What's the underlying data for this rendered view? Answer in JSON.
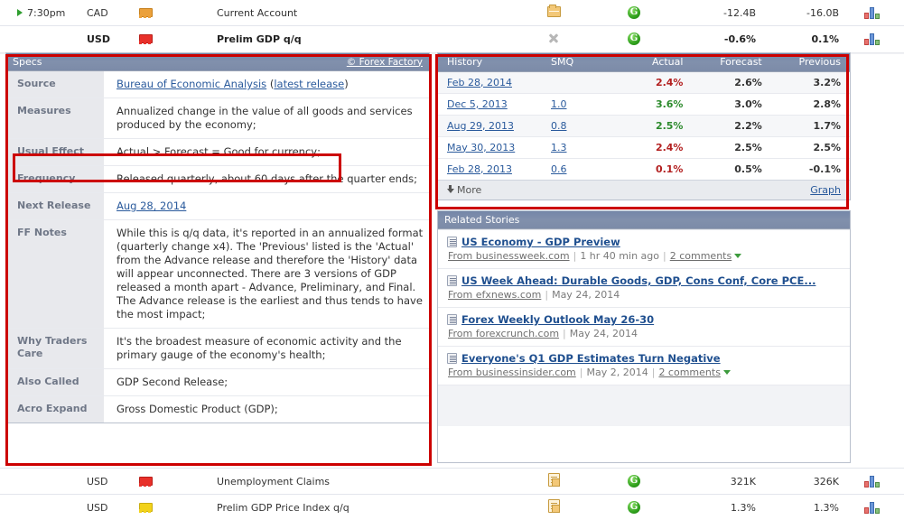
{
  "colors": {
    "accent_header": "#7c8ba8",
    "link": "#2a5a9c",
    "annotation": "#cc0000",
    "actual_up": "#2c8a2c",
    "actual_down": "#b32020"
  },
  "calendar_rows_top": [
    {
      "time": "7:30pm",
      "has_play_icon": true,
      "currency": "CAD",
      "impact_icon": "orange-flag-icon",
      "event": "Current Account",
      "detail_icon": "folder-icon",
      "alert_icon": "g-alert-icon",
      "actual": "-12.4B",
      "forecast": "-16.0B",
      "graph_icon": "bar-chart-icon",
      "bold": false
    },
    {
      "time": "",
      "has_play_icon": false,
      "currency": "USD",
      "impact_icon": "red-flag-icon",
      "event": "Prelim GDP q/q",
      "detail_icon": "x-close-icon",
      "alert_icon": "g-alert-icon",
      "actual": "-0.6%",
      "forecast": "0.1%",
      "graph_icon": "bar-chart-icon",
      "bold": true
    }
  ],
  "calendar_rows_bottom": [
    {
      "time": "",
      "has_play_icon": false,
      "currency": "USD",
      "impact_icon": "red-flag-icon",
      "event": "Unemployment Claims",
      "detail_icon": "document-icon",
      "alert_icon": "g-alert-icon",
      "actual": "321K",
      "forecast": "326K",
      "graph_icon": "bar-chart-icon",
      "bold": false
    },
    {
      "time": "",
      "has_play_icon": false,
      "currency": "USD",
      "impact_icon": "yellow-flag-icon",
      "event": "Prelim GDP Price Index q/q",
      "detail_icon": "document-icon",
      "alert_icon": "g-alert-icon",
      "actual": "1.3%",
      "forecast": "1.3%",
      "graph_icon": "bar-chart-icon",
      "bold": false
    }
  ],
  "specs": {
    "header_title": "Specs",
    "copyright_link": "© Forex Factory",
    "rows": [
      {
        "label": "Source",
        "value_html": "source_link"
      },
      {
        "label": "Measures",
        "value": "Annualized change in the value of all goods and services produced by the economy;"
      },
      {
        "label": "Usual Effect",
        "value": "Actual > Forecast = Good for currency;"
      },
      {
        "label": "Frequency",
        "value": "Released quarterly, about 60 days after the quarter ends;"
      },
      {
        "label": "Next Release",
        "value_html": "next_release_link"
      },
      {
        "label": "FF Notes",
        "value": "While this is q/q data, it's reported in an annualized format (quarterly change x4). The 'Previous' listed is the 'Actual' from the Advance release and therefore the 'History' data will appear unconnected. There are 3 versions of GDP released a month apart - Advance, Preliminary, and Final. The Advance release is the earliest and thus tends to have the most impact;"
      },
      {
        "label": "Why Traders Care",
        "value": "It's the broadest measure of economic activity and the primary gauge of the economy's health;"
      },
      {
        "label": "Also Called",
        "value": "GDP Second Release;"
      },
      {
        "label": "Acro Expand",
        "value": "Gross Domestic Product (GDP);"
      }
    ],
    "source_link_text": "Bureau of Economic Analysis",
    "source_paren_open": " (",
    "source_latest_release": "latest release",
    "source_paren_close": ")",
    "next_release_link": "Aug 28, 2014"
  },
  "history": {
    "columns": [
      "History",
      "SMQ",
      "Actual",
      "Forecast",
      "Previous"
    ],
    "rows": [
      {
        "date": "Feb 28, 2014",
        "smq": "",
        "actual": "2.4%",
        "actual_dir": "down",
        "forecast": "2.6%",
        "previous": "3.2%"
      },
      {
        "date": "Dec 5, 2013",
        "smq": "1.0",
        "actual": "3.6%",
        "actual_dir": "up",
        "forecast": "3.0%",
        "previous": "2.8%"
      },
      {
        "date": "Aug 29, 2013",
        "smq": "0.8",
        "actual": "2.5%",
        "actual_dir": "up",
        "forecast": "2.2%",
        "previous": "1.7%"
      },
      {
        "date": "May 30, 2013",
        "smq": "1.3",
        "actual": "2.4%",
        "actual_dir": "down",
        "forecast": "2.5%",
        "previous": "2.5%"
      },
      {
        "date": "Feb 28, 2013",
        "smq": "0.6",
        "actual": "0.1%",
        "actual_dir": "down",
        "forecast": "0.5%",
        "previous": "-0.1%"
      }
    ],
    "more_label": "More",
    "graph_label": "Graph"
  },
  "related_stories": {
    "header_title": "Related Stories",
    "items": [
      {
        "title": "US Economy - GDP Preview",
        "source": "From businessweek.com",
        "time": "1 hr 40 min ago",
        "comments": "2 comments",
        "has_comments": true
      },
      {
        "title": "US Week Ahead: Durable Goods, GDP, Cons Conf, Core PCE...",
        "source": "From efxnews.com",
        "time": "May 24, 2014",
        "comments": "",
        "has_comments": false
      },
      {
        "title": "Forex Weekly Outlook May 26-30",
        "source": "From forexcrunch.com",
        "time": "May 24, 2014",
        "comments": "",
        "has_comments": false
      },
      {
        "title": "Everyone's Q1 GDP Estimates Turn Negative",
        "source": "From businessinsider.com",
        "time": "May 2, 2014",
        "comments": "2 comments",
        "has_comments": true
      }
    ]
  }
}
